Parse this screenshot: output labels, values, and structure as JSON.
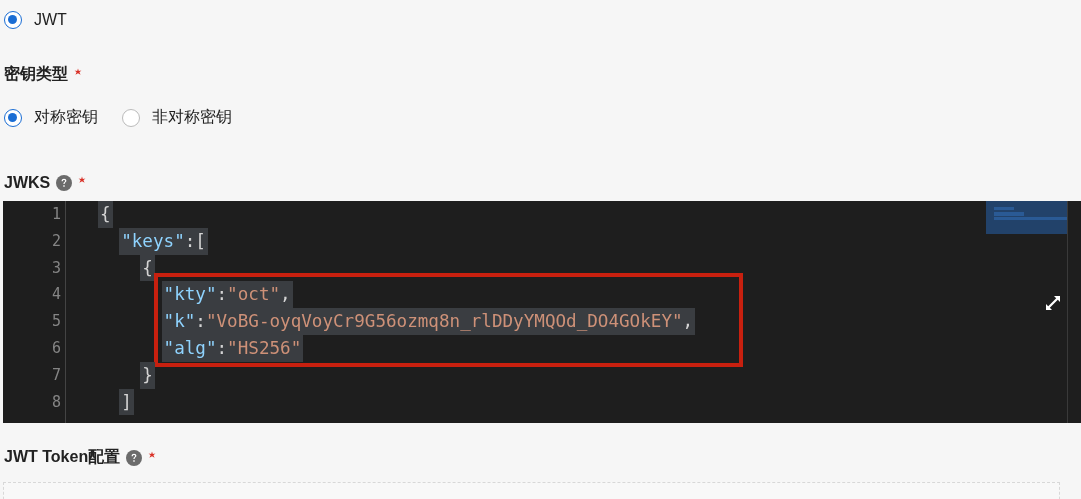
{
  "auth_type": {
    "options": [
      {
        "label": "JWT",
        "selected": true
      }
    ]
  },
  "key_type": {
    "label": "密钥类型",
    "required": true,
    "options": [
      {
        "label": "对称密钥",
        "selected": true
      },
      {
        "label": "非对称密钥",
        "selected": false
      }
    ]
  },
  "jwks": {
    "label": "JWKS",
    "help": true,
    "required": true,
    "text_selected": true,
    "lines": [
      {
        "number": "1",
        "boxed": false,
        "tokens": [
          {
            "kind": "punct",
            "text": "{"
          }
        ]
      },
      {
        "number": "2",
        "boxed": false,
        "tokens": [
          {
            "kind": "key",
            "text": "  \"keys\""
          },
          {
            "kind": "punct",
            "text": ":["
          }
        ]
      },
      {
        "number": "3",
        "boxed": false,
        "tokens": [
          {
            "kind": "punct",
            "text": "    {"
          }
        ]
      },
      {
        "number": "4",
        "boxed": true,
        "tokens": [
          {
            "kind": "key",
            "text": "      \"kty\""
          },
          {
            "kind": "punct",
            "text": ":"
          },
          {
            "kind": "string",
            "text": "\"oct\""
          },
          {
            "kind": "punct",
            "text": ","
          }
        ]
      },
      {
        "number": "5",
        "boxed": true,
        "tokens": [
          {
            "kind": "key",
            "text": "      \"k\""
          },
          {
            "kind": "punct",
            "text": ":"
          },
          {
            "kind": "string",
            "text": "\"VoBG-oyqVoyCr9G56ozmq8n_rlDDyYMQOd_DO4GOkEY\""
          },
          {
            "kind": "punct",
            "text": ","
          }
        ]
      },
      {
        "number": "6",
        "boxed": true,
        "tokens": [
          {
            "kind": "key",
            "text": "      \"alg\""
          },
          {
            "kind": "punct",
            "text": ":"
          },
          {
            "kind": "string",
            "text": "\"HS256\""
          }
        ]
      },
      {
        "number": "7",
        "boxed": false,
        "tokens": [
          {
            "kind": "punct",
            "text": "    }"
          }
        ]
      },
      {
        "number": "8",
        "boxed": false,
        "tokens": [
          {
            "kind": "punct",
            "text": "  ]"
          }
        ]
      }
    ]
  },
  "jwt_token_config": {
    "label": "JWT Token配置",
    "help": true,
    "required": true
  }
}
